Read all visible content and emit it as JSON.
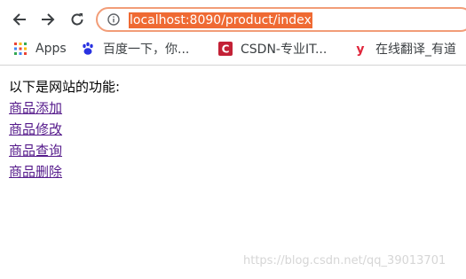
{
  "browser": {
    "url": "localhost:8090/product/index",
    "bookmarks": [
      {
        "label": "Apps",
        "icon": "apps-grid-icon"
      },
      {
        "label": "百度一下，你...",
        "icon": "baidu-paw-icon"
      },
      {
        "label": "CSDN-专业IT...",
        "icon": "csdn-logo-icon"
      },
      {
        "label": "在线翻译_有道",
        "icon": "youdao-logo-icon"
      }
    ]
  },
  "page": {
    "intro": "以下是网站的功能:",
    "links": [
      "商品添加",
      "商品修改",
      "商品查询",
      "商品删除"
    ]
  },
  "watermark": "https://blog.csdn.net/qq_39013701",
  "colors": {
    "url_highlight": "#ef6a33",
    "omnibox_border": "#f29d78",
    "visited_link": "#551a8b"
  }
}
